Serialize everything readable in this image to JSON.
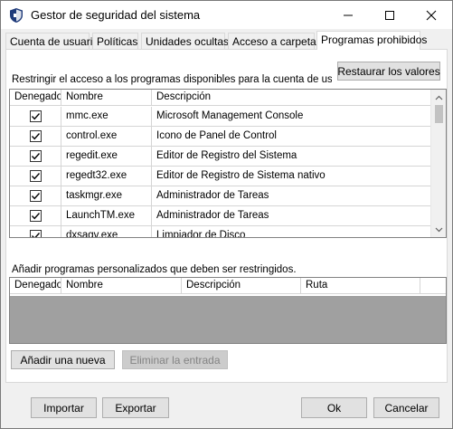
{
  "window": {
    "title": "Gestor de seguridad del sistema"
  },
  "tabs": [
    {
      "label": "Cuenta de usuario"
    },
    {
      "label": "Políticas"
    },
    {
      "label": "Unidades ocultas"
    },
    {
      "label": "Acceso a carpetas"
    },
    {
      "label": "Programas prohibidos"
    }
  ],
  "panel": {
    "restrict_label": "Restringir el acceso a los programas disponibles para la cuenta de usuario s",
    "restore_button": "Restaurar los valores",
    "programs_grid": {
      "columns": [
        "Denegado",
        "Nombre",
        "Descripción"
      ],
      "rows": [
        {
          "denied": true,
          "name": "mmc.exe",
          "description": "Microsoft Management Console"
        },
        {
          "denied": true,
          "name": "control.exe",
          "description": "Icono de Panel de Control"
        },
        {
          "denied": true,
          "name": "regedit.exe",
          "description": "Editor de Registro del Sistema"
        },
        {
          "denied": true,
          "name": "regedt32.exe",
          "description": "Editor de Registro de Sistema nativo"
        },
        {
          "denied": true,
          "name": "taskmgr.exe",
          "description": "Administrador de Tareas"
        },
        {
          "denied": true,
          "name": "LaunchTM.exe",
          "description": "Administrador de Tareas"
        },
        {
          "denied": true,
          "name": "dxsagv.exe",
          "description": "Limpiador de Disco"
        }
      ]
    },
    "custom_label": "Añadir programas personalizados que deben ser restringidos.",
    "custom_grid": {
      "columns": [
        "Denegado",
        "Nombre",
        "Descripción",
        "Ruta"
      ]
    },
    "add_button": "Añadir una nueva",
    "remove_button": "Eliminar la entrada"
  },
  "footer": {
    "import_button": "Importar",
    "export_button": "Exportar",
    "ok_button": "Ok",
    "cancel_button": "Cancelar"
  },
  "colors": {
    "shield_icon": "#1f3b7a",
    "grid_empty": "#a0a0a0",
    "disabled_text": "#838383"
  }
}
